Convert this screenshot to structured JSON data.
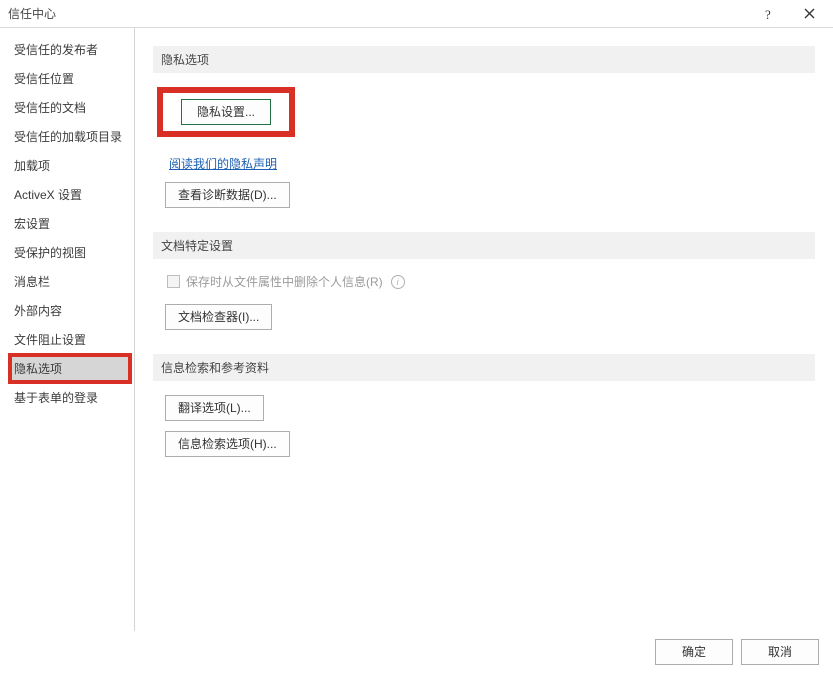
{
  "window": {
    "title": "信任中心"
  },
  "sidebar": {
    "items": [
      {
        "label": "受信任的发布者"
      },
      {
        "label": "受信任位置"
      },
      {
        "label": "受信任的文档"
      },
      {
        "label": "受信任的加载项目录"
      },
      {
        "label": "加载项"
      },
      {
        "label": "ActiveX 设置"
      },
      {
        "label": "宏设置"
      },
      {
        "label": "受保护的视图"
      },
      {
        "label": "消息栏"
      },
      {
        "label": "外部内容"
      },
      {
        "label": "文件阻止设置"
      },
      {
        "label": "隐私选项"
      },
      {
        "label": "基于表单的登录"
      }
    ],
    "selectedIndex": 11,
    "highlightIndex": 11
  },
  "sections": {
    "privacy": {
      "header": "隐私选项",
      "privacy_settings_btn": "隐私设置...",
      "privacy_link": "阅读我们的隐私声明",
      "diagnostics_btn": "查看诊断数据(D)..."
    },
    "docSpecific": {
      "header": "文档特定设置",
      "checkbox_label": "保存时从文件属性中删除个人信息(R)",
      "inspector_btn": "文档检查器(I)..."
    },
    "research": {
      "header": "信息检索和参考资料",
      "translate_btn": "翻译选项(L)...",
      "research_btn": "信息检索选项(H)..."
    }
  },
  "footer": {
    "ok": "确定",
    "cancel": "取消"
  }
}
